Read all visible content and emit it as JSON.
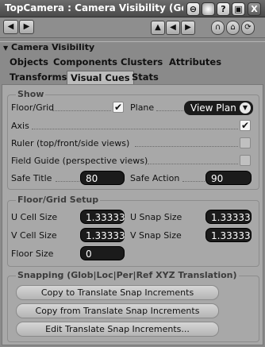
{
  "window": {
    "title": "TopCamera : Camera Visibility (Gen...",
    "controls": {
      "minimize_icon": "⊖",
      "help_icon": "?",
      "close_label": "X"
    }
  },
  "toolbar": {
    "back_icon": "◀",
    "forward_icon": "▶",
    "up_icon": "▲",
    "left_icon": "◀",
    "right_icon": "▶",
    "lock_icon": "∩",
    "pin_icon": "⌂",
    "refresh_icon": "⟳"
  },
  "section": {
    "collapse_icon": "▼",
    "title": "Camera Visibility"
  },
  "tabs_row1": [
    "Objects",
    "Components",
    "Clusters",
    "Attributes"
  ],
  "tabs_row2": [
    "Transforms",
    "Visual Cues",
    "Stats"
  ],
  "active_tab": "Visual Cues",
  "show": {
    "title": "Show",
    "floor_grid_label": "Floor/Grid",
    "floor_grid_checked": true,
    "plane_label": "Plane",
    "plane_value": "View Plan",
    "axis_label": "Axis",
    "axis_checked": true,
    "ruler_label": "Ruler (top/front/side views)",
    "ruler_checked": false,
    "field_guide_label": "Field Guide (perspective views)",
    "field_guide_checked": false,
    "safe_title_label": "Safe Title",
    "safe_title_value": "80",
    "safe_action_label": "Safe Action",
    "safe_action_value": "90"
  },
  "floor_grid_setup": {
    "title": "Floor/Grid Setup",
    "u_cell_label": "U Cell Size",
    "u_cell_value": "1.33333",
    "u_snap_label": "U Snap Size",
    "u_snap_value": "1.33333",
    "v_cell_label": "V Cell Size",
    "v_cell_value": "1.33333",
    "v_snap_label": "V Snap Size",
    "v_snap_value": "1.33333",
    "floor_size_label": "Floor Size",
    "floor_size_value": "0"
  },
  "snapping": {
    "title": "Snapping (Glob|Loc|Per|Ref XYZ Translation)",
    "buttons": [
      "Copy to Translate Snap Increments",
      "Copy from Translate Snap Increments",
      "Edit Translate Snap Increments..."
    ]
  }
}
